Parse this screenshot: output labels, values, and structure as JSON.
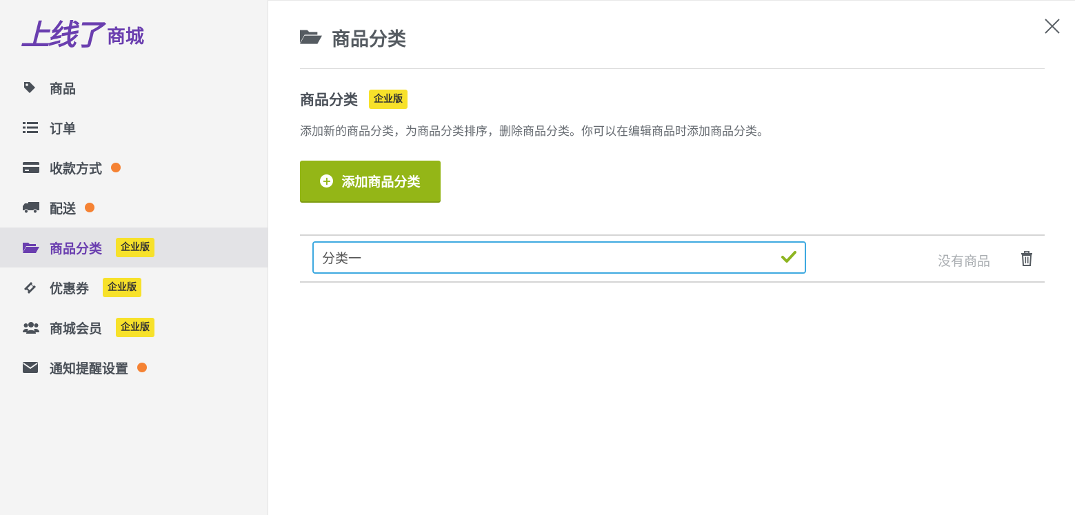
{
  "brand": {
    "main": "上线了",
    "sub": "商城",
    "color": "#6a3eaf"
  },
  "sidebar": {
    "items": [
      {
        "label": "商品",
        "icon": "tag-icon",
        "dot": false,
        "badge": ""
      },
      {
        "label": "订单",
        "icon": "list-icon",
        "dot": false,
        "badge": ""
      },
      {
        "label": "收款方式",
        "icon": "credit-card-icon",
        "dot": true,
        "badge": ""
      },
      {
        "label": "配送",
        "icon": "truck-icon",
        "dot": true,
        "badge": ""
      },
      {
        "label": "商品分类",
        "icon": "folder-open-icon",
        "dot": false,
        "badge": "企业版",
        "active": true
      },
      {
        "label": "优惠券",
        "icon": "ticket-icon",
        "dot": false,
        "badge": "企业版"
      },
      {
        "label": "商城会员",
        "icon": "users-icon",
        "dot": false,
        "badge": "企业版"
      },
      {
        "label": "通知提醒设置",
        "icon": "envelope-icon",
        "dot": true,
        "badge": ""
      }
    ]
  },
  "header": {
    "title": "商品分类",
    "icon": "folder-open-icon",
    "close_icon": "close-icon"
  },
  "section": {
    "title": "商品分类",
    "badge": "企业版",
    "description": "添加新的商品分类，为商品分类排序，删除商品分类。你可以在编辑商品时添加商品分类。"
  },
  "add_button": {
    "label": "添加商品分类",
    "icon": "plus-circle-icon"
  },
  "categories": [
    {
      "name": "分类一",
      "status": "没有商品",
      "confirm_icon": "check-icon",
      "delete_icon": "trash-icon"
    }
  ],
  "colors": {
    "accent": "#6a3eaf",
    "badge": "#f7e12a",
    "dot": "#f58233",
    "button": "#94b617",
    "input_border": "#3ea9e0"
  }
}
